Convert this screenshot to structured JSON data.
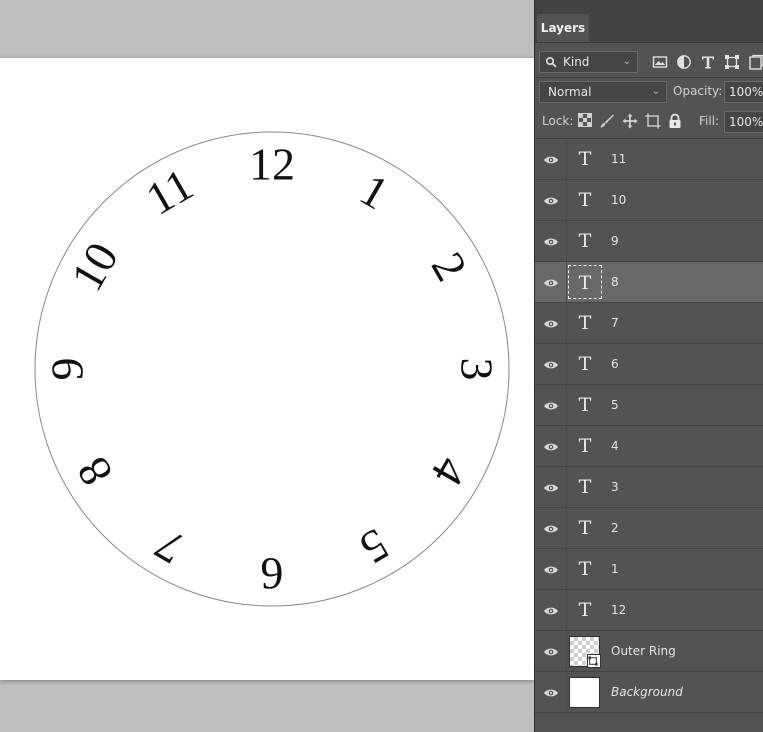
{
  "canvas": {
    "numerals": [
      "12",
      "1",
      "2",
      "3",
      "4",
      "5",
      "6",
      "7",
      "8",
      "9",
      "10",
      "11"
    ]
  },
  "panel": {
    "tab_label": "Layers",
    "filter": {
      "value": "Kind",
      "icons": [
        "image-filter-icon",
        "adjustment-filter-icon",
        "type-filter-icon",
        "shape-filter-icon",
        "smart-object-filter-icon"
      ]
    },
    "blend_mode": "Normal",
    "opacity_label": "Opacity:",
    "opacity_value": "100%",
    "lock_label": "Lock:",
    "lock_icons": [
      "lock-transparent-pixels-icon",
      "lock-image-pixels-icon",
      "lock-position-icon",
      "lock-artboard-icon",
      "lock-all-icon"
    ],
    "fill_label": "Fill:",
    "fill_value": "100%"
  },
  "layers": [
    {
      "name": "11",
      "type": "text",
      "selected": false
    },
    {
      "name": "10",
      "type": "text",
      "selected": false
    },
    {
      "name": "9",
      "type": "text",
      "selected": false
    },
    {
      "name": "8",
      "type": "text",
      "selected": true
    },
    {
      "name": "7",
      "type": "text",
      "selected": false
    },
    {
      "name": "6",
      "type": "text",
      "selected": false
    },
    {
      "name": "5",
      "type": "text",
      "selected": false
    },
    {
      "name": "4",
      "type": "text",
      "selected": false
    },
    {
      "name": "3",
      "type": "text",
      "selected": false
    },
    {
      "name": "2",
      "type": "text",
      "selected": false
    },
    {
      "name": "1",
      "type": "text",
      "selected": false
    },
    {
      "name": "12",
      "type": "text",
      "selected": false
    },
    {
      "name": "Outer Ring",
      "type": "smart",
      "selected": false
    },
    {
      "name": "Background",
      "type": "background",
      "selected": false
    }
  ],
  "colors": {
    "panel_bg": "#535353",
    "selected_row": "#686868",
    "canvas_bg": "#bebebe"
  }
}
